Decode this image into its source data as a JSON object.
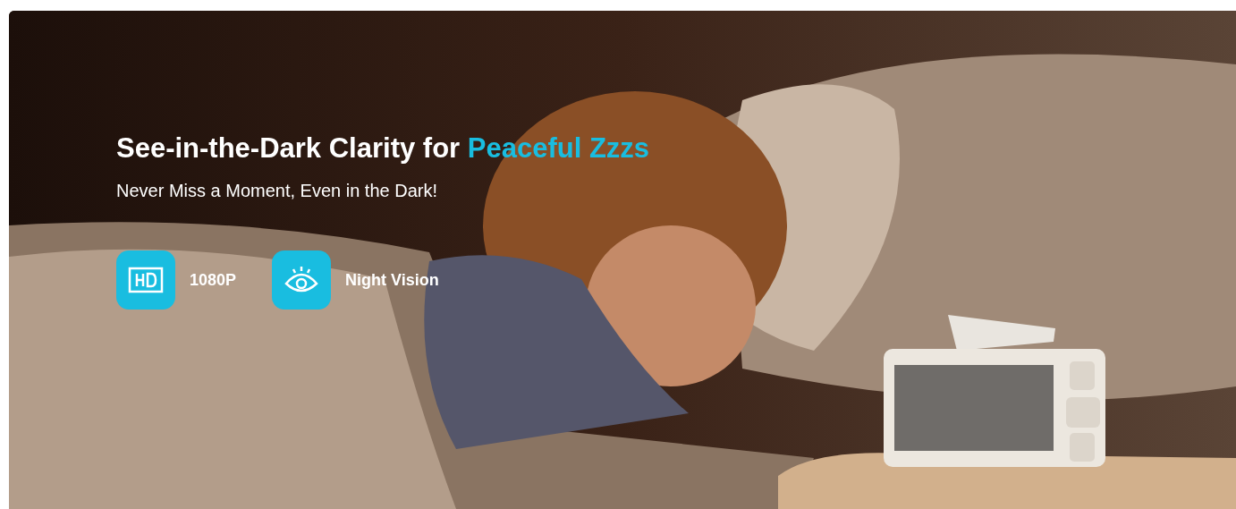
{
  "banner": {
    "headline": {
      "text": "See-in-the-Dark Clarity for ",
      "highlight": "Peaceful Zzzs"
    },
    "subtitle": "Never Miss a Moment, Even in the Dark!",
    "features": [
      {
        "kind": "hd",
        "label": "1080P"
      },
      {
        "kind": "eye",
        "label": "Night Vision"
      }
    ]
  }
}
